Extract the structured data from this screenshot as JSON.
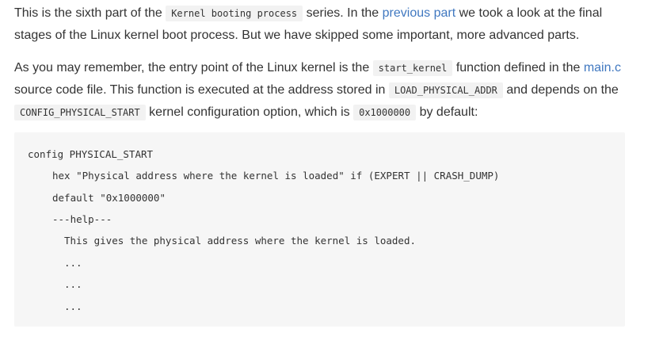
{
  "paragraph1": {
    "t1": "This is the sixth part of the ",
    "code1": "Kernel booting process",
    "t2": " series. In the ",
    "link1": "previous part",
    "t3": " we took a look at the final stages of the Linux kernel boot process. But we have skipped some important, more advanced parts."
  },
  "paragraph2": {
    "t1": "As you may remember, the entry point of the Linux kernel is the ",
    "code1": "start_kernel",
    "t2": " function defined in the ",
    "link1": "main.c",
    "t3": " source code file. This function is executed at the address stored in ",
    "code2": "LOAD_PHYSICAL_ADDR",
    "t4": " and depends on the ",
    "code3": "CONFIG_PHYSICAL_START",
    "t5": " kernel configuration option, which is ",
    "code4": "0x1000000",
    "t6": " by default:"
  },
  "code_block": {
    "lines": [
      "config PHYSICAL_START",
      "hex \"Physical address where the kernel is loaded\" if (EXPERT || CRASH_DUMP)",
      "default \"0x1000000\"",
      "---help---",
      "This gives the physical address where the kernel is loaded.",
      "...",
      "...",
      "..."
    ]
  }
}
